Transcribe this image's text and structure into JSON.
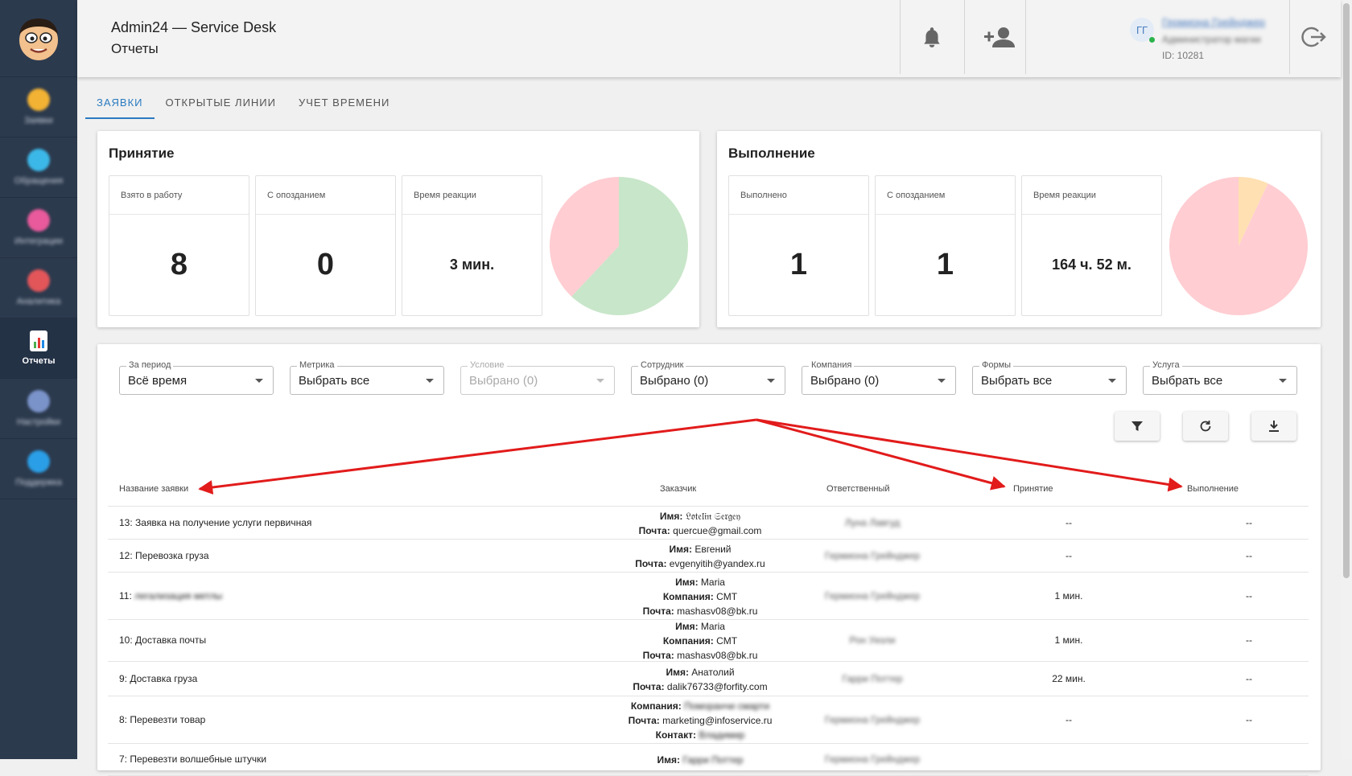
{
  "header": {
    "title": "Admin24 — Service Desk",
    "subtitle": "Отчеты",
    "user": {
      "initials": "ГГ",
      "name": "Гермиона Грейнджер",
      "role": "Администратор магии",
      "id": "ID: 10281"
    }
  },
  "sidebar": {
    "items": [
      {
        "label": "Заявки",
        "color": "#f2b233"
      },
      {
        "label": "Обращения",
        "color": "#3cb8e8"
      },
      {
        "label": "Интеграции",
        "color": "#e85a9b"
      },
      {
        "label": "Аналитика",
        "color": "#e2565a"
      },
      {
        "label": "Отчеты",
        "color": "#4caf50"
      },
      {
        "label": "Настройки",
        "color": "#7a93c9"
      },
      {
        "label": "Поддержка",
        "color": "#2a9ee6"
      }
    ]
  },
  "tabs": [
    "ЗАЯВКИ",
    "ОТКРЫТЫЕ ЛИНИИ",
    "УЧЕТ ВРЕМЕНИ"
  ],
  "cards": {
    "accept": {
      "title": "Принятие",
      "stats": [
        {
          "label": "Взято в работу",
          "value": "8"
        },
        {
          "label": "С опозданием",
          "value": "0"
        },
        {
          "label": "Время реакции",
          "value": "3 мин."
        }
      ],
      "pie": {
        "slices": [
          {
            "value": 62,
            "color": "#c8e6c9"
          },
          {
            "value": 38,
            "color": "#ffcdd2"
          }
        ]
      }
    },
    "complete": {
      "title": "Выполнение",
      "stats": [
        {
          "label": "Выполнено",
          "value": "1"
        },
        {
          "label": "С опозданием",
          "value": "1"
        },
        {
          "label": "Время реакции",
          "value": "164 ч. 52 м."
        }
      ],
      "pie": {
        "slices": [
          {
            "value": 7,
            "color": "#ffe0b2"
          },
          {
            "value": 93,
            "color": "#ffcdd2"
          }
        ]
      }
    }
  },
  "filters": [
    {
      "label": "За период",
      "value": "Всё время",
      "disabled": false
    },
    {
      "label": "Метрика",
      "value": "Выбрать все",
      "disabled": false
    },
    {
      "label": "Условие",
      "value": "Выбрано (0)",
      "disabled": true
    },
    {
      "label": "Сотрудник",
      "value": "Выбрано (0)",
      "disabled": false
    },
    {
      "label": "Компания",
      "value": "Выбрано (0)",
      "disabled": false
    },
    {
      "label": "Формы",
      "value": "Выбрать все",
      "disabled": false
    },
    {
      "label": "Услуга",
      "value": "Выбрать все",
      "disabled": false
    }
  ],
  "table": {
    "columns": [
      "Название заявки",
      "Заказчик",
      "Ответственный",
      "Принятие",
      "Выполнение"
    ],
    "rows": [
      {
        "name": "13: Заявка на получение услуги первичная",
        "customer": [
          [
            "Имя:",
            "𝔏𝔬𝔱𝔢𝔩𝔦𝔫 𝔖𝔢𝔯𝔤𝔢𝔶"
          ],
          [
            "Почта:",
            "quercue@gmail.com"
          ]
        ],
        "resp": "Луна Лавгуд",
        "accept": "--",
        "done": "--"
      },
      {
        "name": "12: Перевозка груза",
        "customer": [
          [
            "Имя:",
            "Евгений"
          ],
          [
            "Почта:",
            "evgenyitih@yandex.ru"
          ]
        ],
        "resp": "Гермиона Грейнджер",
        "accept": "--",
        "done": "--"
      },
      {
        "name": "11: ",
        "name_hidden": "легализация метлы",
        "customer": [
          [
            "Имя:",
            "Maria"
          ],
          [
            "Компания:",
            "CMT"
          ],
          [
            "Почта:",
            "mashasv08@bk.ru"
          ]
        ],
        "resp": "Гермиона Грейнджер",
        "accept": "1 мин.",
        "done": "--"
      },
      {
        "name": "10: Доставка почты",
        "customer": [
          [
            "Имя:",
            "Maria"
          ],
          [
            "Компания:",
            "CMT"
          ],
          [
            "Почта:",
            "mashasv08@bk.ru"
          ]
        ],
        "resp": "Рон Уизли",
        "accept": "1 мин.",
        "done": "--"
      },
      {
        "name": "9: Доставка груза",
        "customer": [
          [
            "Имя:",
            "Анатолий"
          ],
          [
            "Почта:",
            "dalik76733@forfity.com"
          ]
        ],
        "resp": "Гарри Поттер",
        "accept": "22 мин.",
        "done": "--"
      },
      {
        "name": "8: Перевезти товар",
        "customer": [
          [
            "Компания:",
            "Поморанчи смарти"
          ],
          [
            "Почта:",
            "marketing@infoservice.ru"
          ],
          [
            "Контакт:",
            "Владимир"
          ]
        ],
        "resp": "Гермиона Грейнджер",
        "accept": "--",
        "done": "--"
      },
      {
        "name": "7: Перевезти волшебные штучки",
        "customer": [
          [
            "Имя:",
            "Гарри Поттер"
          ]
        ],
        "resp": "Гермиона Грейнджер",
        "accept": "",
        "done": ""
      }
    ]
  }
}
